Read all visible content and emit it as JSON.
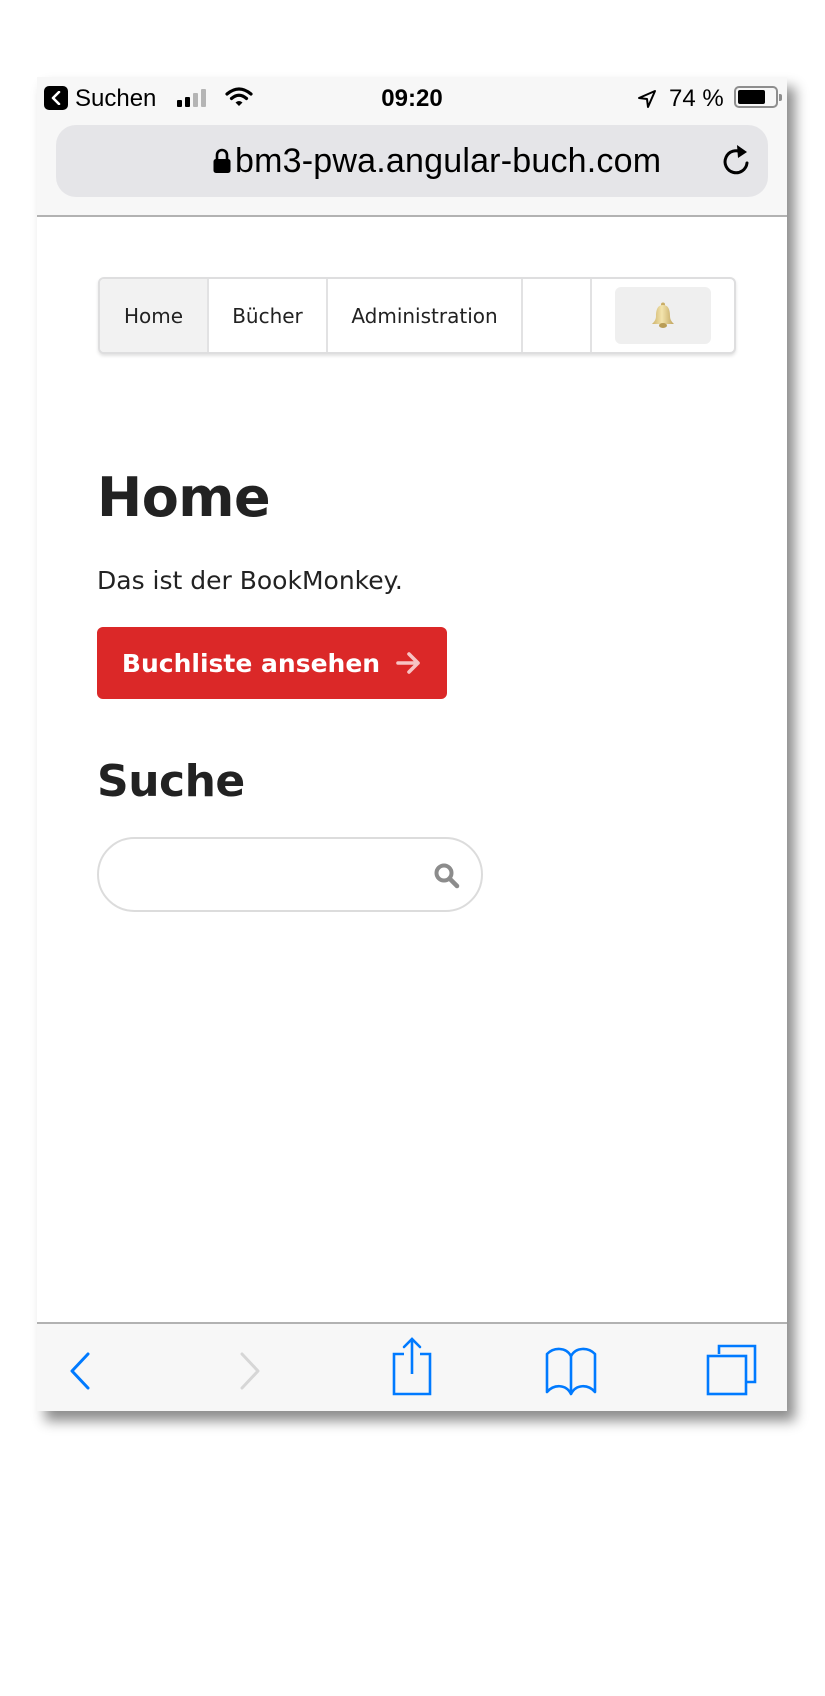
{
  "status_bar": {
    "back_app_label": "Suchen",
    "time": "09:20",
    "battery_percent_label": "74 %",
    "battery_level": 0.74,
    "signal_bars_filled": 2,
    "signal_bars_total": 4
  },
  "browser": {
    "url": "bm3-pwa.angular-buch.com",
    "icons": {
      "lock": "lock-icon",
      "reload": "reload-icon"
    }
  },
  "nav": {
    "items": [
      {
        "label": "Home",
        "active": true
      },
      {
        "label": "Bücher",
        "active": false
      },
      {
        "label": "Administration",
        "active": false
      },
      {
        "label": "",
        "active": false
      }
    ],
    "bell_icon": "🔔"
  },
  "main": {
    "title": "Home",
    "intro": "Das ist der BookMonkey.",
    "booklist_button": "Buchliste ansehen",
    "booklist_button_icon": "→",
    "search_title": "Suche",
    "search_value": "",
    "search_placeholder": ""
  },
  "toolbar": {
    "items": [
      "back",
      "forward",
      "share",
      "bookmarks",
      "tabs"
    ],
    "forward_enabled": false
  },
  "colors": {
    "accent_red": "#db2828",
    "ios_blue": "#007aff",
    "disabled_gray": "#d6d6d6"
  }
}
